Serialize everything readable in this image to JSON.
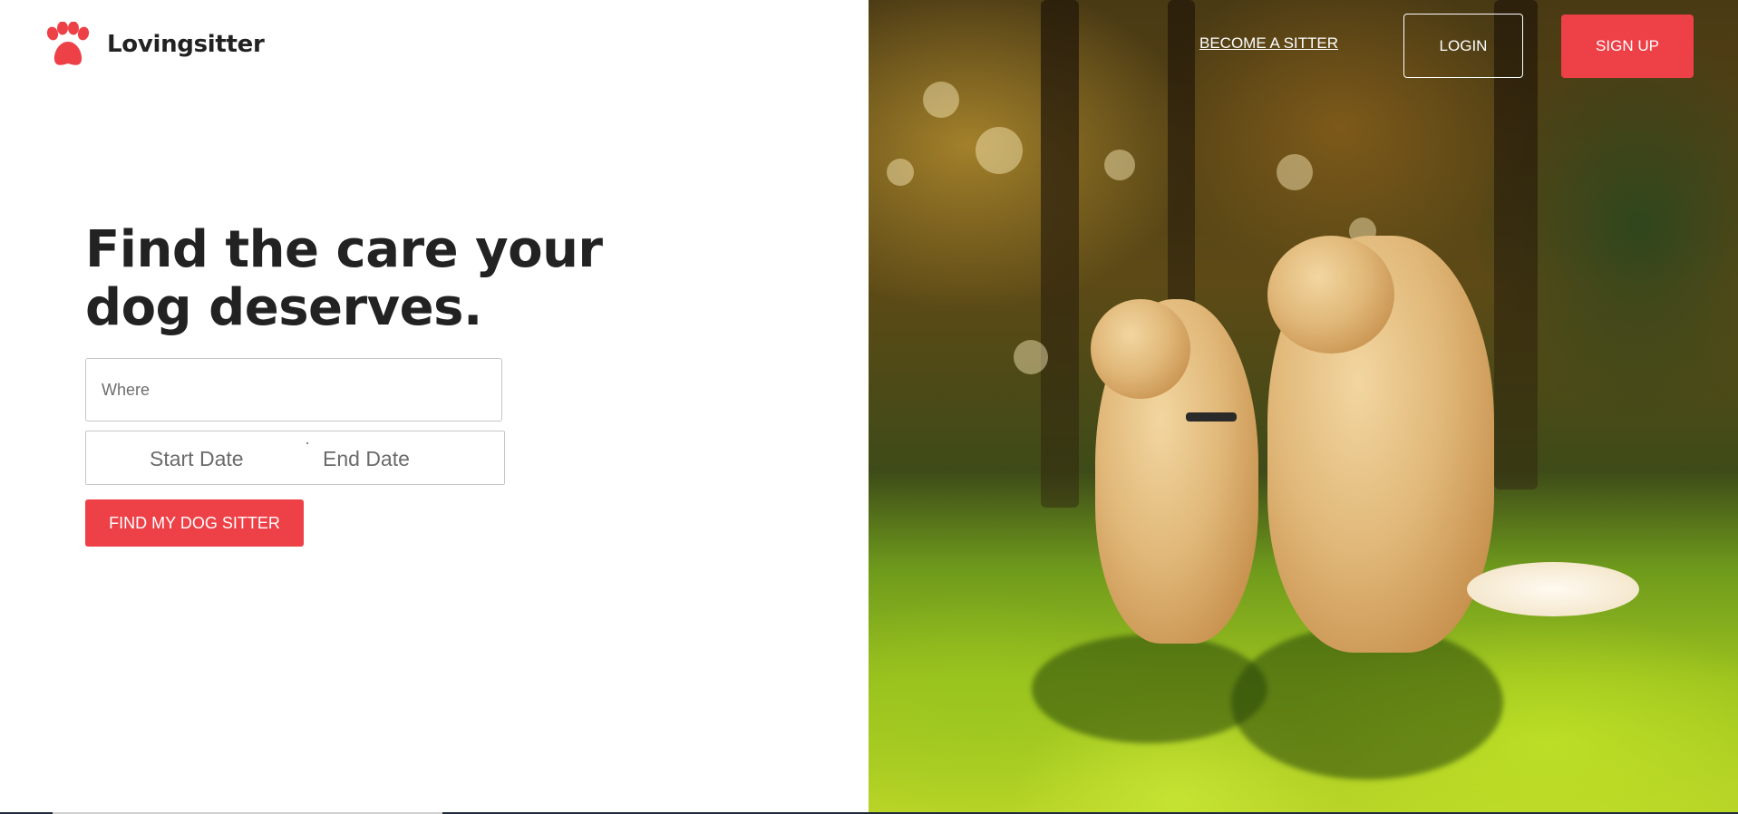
{
  "brand": {
    "name": "Lovingsitter",
    "logo_icon": "paw-icon",
    "accent_color": "#ee4047"
  },
  "nav": {
    "become_sitter": "BECOME A SITTER",
    "login": "LOGIN",
    "signup": "SIGN UP"
  },
  "hero": {
    "headline": "Find the care your dog deserves.",
    "image": "two-dogs-sitting-on-grass"
  },
  "search": {
    "where_placeholder": "Where",
    "start_date_placeholder": "Start Date",
    "end_date_placeholder": "End Date",
    "submit_label": "FIND MY DOG SITTER"
  }
}
